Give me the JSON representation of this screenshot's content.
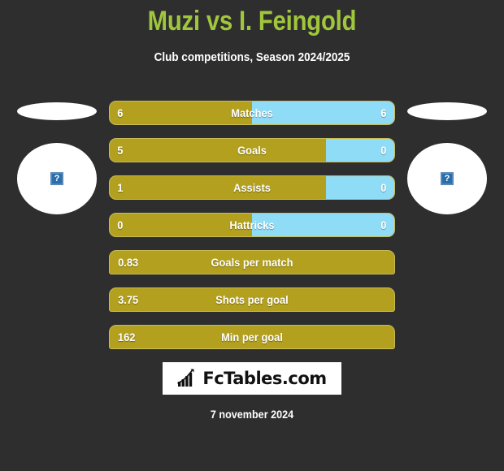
{
  "header": {
    "title": "Muzi vs I. Feingold",
    "subtitle": "Club competitions, Season 2024/2025"
  },
  "colors": {
    "background": "#2e2e2e",
    "title_green": "#a0c63c",
    "home_gold": "#b3a01e",
    "away_blue": "#8fdcf6",
    "bar_border": "#c9bb55",
    "text_white": "#ffffff"
  },
  "players": {
    "home": {
      "name": "",
      "photo_icon": "broken-image-icon",
      "photo_alt": "?"
    },
    "away": {
      "name": "",
      "photo_icon": "broken-image-icon",
      "photo_alt": "?"
    }
  },
  "stats": [
    {
      "label": "Matches",
      "home": "6",
      "away": "6",
      "home_pct": 50,
      "split": true
    },
    {
      "label": "Goals",
      "home": "5",
      "away": "0",
      "home_pct": 76,
      "split": true
    },
    {
      "label": "Assists",
      "home": "1",
      "away": "0",
      "home_pct": 76,
      "split": true
    },
    {
      "label": "Hattricks",
      "home": "0",
      "away": "0",
      "home_pct": 50,
      "split": true
    },
    {
      "label": "Goals per match",
      "home": "0.83",
      "away": "",
      "home_pct": 100,
      "split": false
    },
    {
      "label": "Shots per goal",
      "home": "3.75",
      "away": "",
      "home_pct": 100,
      "split": false
    },
    {
      "label": "Min per goal",
      "home": "162",
      "away": "",
      "home_pct": 100,
      "split": false
    }
  ],
  "footer": {
    "logo_icon": "bar-chart-growth-icon",
    "logo_text": "FcTables.com",
    "date": "7 november 2024"
  }
}
